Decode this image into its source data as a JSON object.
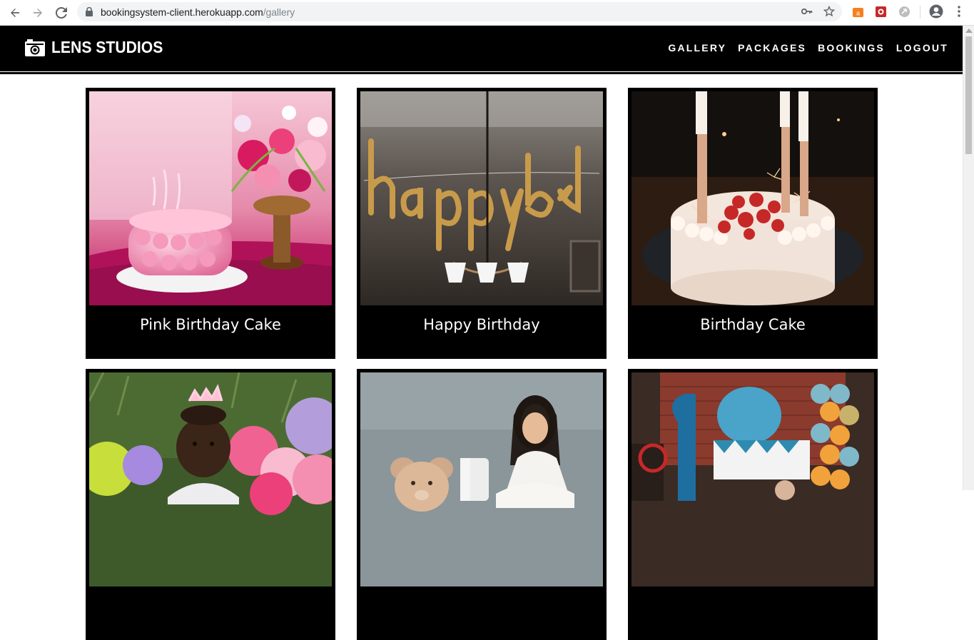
{
  "browser": {
    "url_host": "bookingsystem-client.herokuapp.com",
    "url_path": "/gallery"
  },
  "site": {
    "logo_text": "LENS STUDIOS",
    "nav": [
      {
        "label": "GALLERY"
      },
      {
        "label": "PACKAGES"
      },
      {
        "label": "BOOKINGS"
      },
      {
        "label": "LOGOUT"
      }
    ]
  },
  "gallery": {
    "items": [
      {
        "caption": "Pink Birthday Cake"
      },
      {
        "caption": "Happy Birthday"
      },
      {
        "caption": "Birthday Cake"
      },
      {
        "caption": ""
      },
      {
        "caption": ""
      },
      {
        "caption": ""
      }
    ]
  },
  "colors": {
    "header_bg": "#000000",
    "card_bg": "#000000",
    "text_light": "#ffffff"
  }
}
